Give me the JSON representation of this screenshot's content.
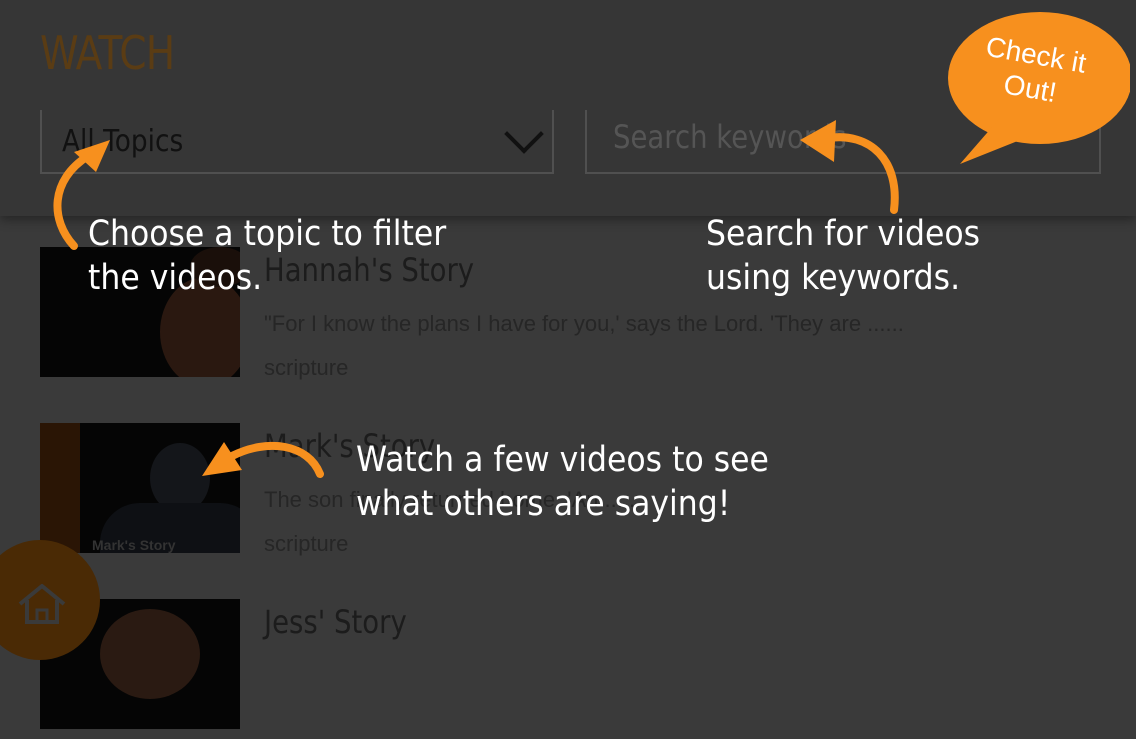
{
  "header": {
    "title": "WATCH",
    "topic_select": {
      "value": "All Topics"
    },
    "search": {
      "placeholder": "Search keywords"
    }
  },
  "videos": [
    {
      "title": "Hannah's Story",
      "description": "\"For I know the plans I have for you,' says the Lord. 'They are ......",
      "tag": "scripture"
    },
    {
      "title": "Mark's Story",
      "description": "The son finally returned home. 'An......",
      "tag": "scripture",
      "thumb_caption": "Mark's Story"
    },
    {
      "title": "Jess' Story"
    }
  ],
  "coach_marks": {
    "topic_tip": [
      "Choose a topic to filter",
      "the videos."
    ],
    "search_tip": [
      "Search for videos",
      "using keywords."
    ],
    "watch_tip": [
      "Watch a few videos to see",
      "what others are saying!"
    ],
    "bubble": [
      "Check it",
      "Out!"
    ]
  },
  "colors": {
    "accent": "#f7901e",
    "overlay": "#3a3a3a",
    "dim_title": "#5a3c14"
  },
  "icons": {
    "home": "home-icon",
    "dropdown": "chevron-down-icon"
  }
}
